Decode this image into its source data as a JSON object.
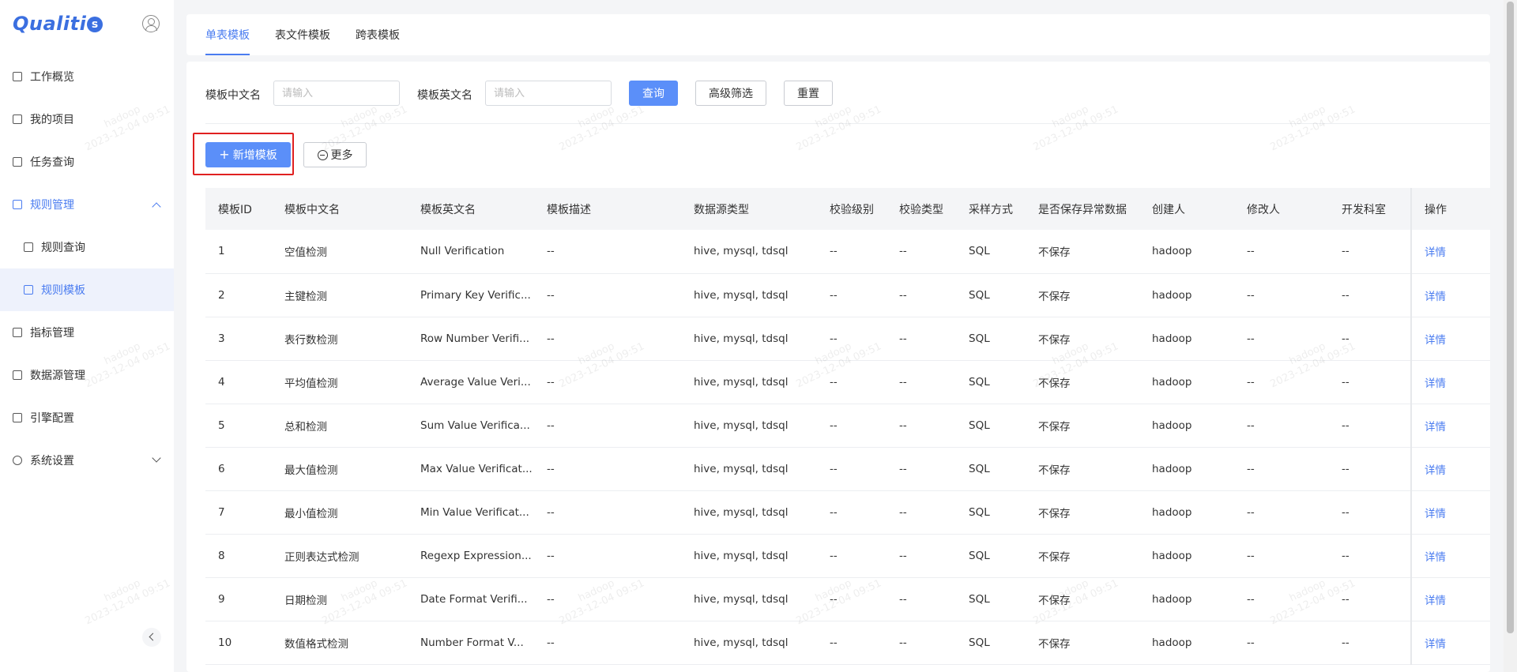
{
  "app": {
    "logo_text": "Qualiti",
    "logo_badge": "s"
  },
  "sidebar": {
    "items": [
      {
        "label": "工作概览"
      },
      {
        "label": "我的项目"
      },
      {
        "label": "任务查询"
      },
      {
        "label": "规则管理"
      },
      {
        "label": "规则查询"
      },
      {
        "label": "规则模板"
      },
      {
        "label": "指标管理"
      },
      {
        "label": "数据源管理"
      },
      {
        "label": "引擎配置"
      },
      {
        "label": "系统设置"
      }
    ]
  },
  "tabs": [
    {
      "label": "单表模板"
    },
    {
      "label": "表文件模板"
    },
    {
      "label": "跨表模板"
    }
  ],
  "filters": {
    "cn_name_label": "模板中文名",
    "cn_name_placeholder": "请输入",
    "en_name_label": "模板英文名",
    "en_name_placeholder": "请输入",
    "search_button": "查询",
    "advanced_button": "高级筛选",
    "reset_button": "重置"
  },
  "actions": {
    "add_button": "新增模板",
    "more_button": "更多"
  },
  "table": {
    "headers": [
      "模板ID",
      "模板中文名",
      "模板英文名",
      "模板描述",
      "数据源类型",
      "校验级别",
      "校验类型",
      "采样方式",
      "是否保存异常数据",
      "创建人",
      "修改人",
      "开发科室",
      "操作"
    ],
    "rows": [
      [
        "1",
        "空值检测",
        "Null Verification",
        "--",
        "hive, mysql, tdsql",
        "--",
        "--",
        "SQL",
        "不保存",
        "hadoop",
        "--",
        "--",
        "详情"
      ],
      [
        "2",
        "主键检测",
        "Primary Key Verific...",
        "--",
        "hive, mysql, tdsql",
        "--",
        "--",
        "SQL",
        "不保存",
        "hadoop",
        "--",
        "--",
        "详情"
      ],
      [
        "3",
        "表行数检测",
        "Row Number Verifi...",
        "--",
        "hive, mysql, tdsql",
        "--",
        "--",
        "SQL",
        "不保存",
        "hadoop",
        "--",
        "--",
        "详情"
      ],
      [
        "4",
        "平均值检测",
        "Average Value Veri...",
        "--",
        "hive, mysql, tdsql",
        "--",
        "--",
        "SQL",
        "不保存",
        "hadoop",
        "--",
        "--",
        "详情"
      ],
      [
        "5",
        "总和检测",
        "Sum Value Verifica...",
        "--",
        "hive, mysql, tdsql",
        "--",
        "--",
        "SQL",
        "不保存",
        "hadoop",
        "--",
        "--",
        "详情"
      ],
      [
        "6",
        "最大值检测",
        "Max Value Verificat...",
        "--",
        "hive, mysql, tdsql",
        "--",
        "--",
        "SQL",
        "不保存",
        "hadoop",
        "--",
        "--",
        "详情"
      ],
      [
        "7",
        "最小值检测",
        "Min Value Verificat...",
        "--",
        "hive, mysql, tdsql",
        "--",
        "--",
        "SQL",
        "不保存",
        "hadoop",
        "--",
        "--",
        "详情"
      ],
      [
        "8",
        "正则表达式检测",
        "Regexp Expression...",
        "--",
        "hive, mysql, tdsql",
        "--",
        "--",
        "SQL",
        "不保存",
        "hadoop",
        "--",
        "--",
        "详情"
      ],
      [
        "9",
        "日期检测",
        "Date Format Verifi...",
        "--",
        "hive, mysql, tdsql",
        "--",
        "--",
        "SQL",
        "不保存",
        "hadoop",
        "--",
        "--",
        "详情"
      ],
      [
        "10",
        "数值格式检测",
        "Number Format V...",
        "--",
        "hive, mysql, tdsql",
        "--",
        "--",
        "SQL",
        "不保存",
        "hadoop",
        "--",
        "--",
        "详情"
      ]
    ]
  },
  "watermark": {
    "user": "hadoop",
    "time": "2023-12-04 09:51"
  },
  "colors": {
    "accent": "#4a7cf0",
    "primary_button": "#5b8ff9",
    "highlight": "#e02020"
  }
}
